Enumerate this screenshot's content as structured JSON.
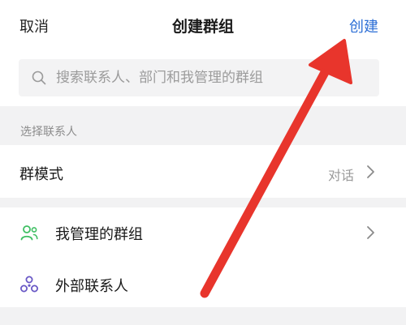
{
  "header": {
    "cancel_label": "取消",
    "title": "创建群组",
    "create_label": "创建"
  },
  "search": {
    "placeholder": "搜索联系人、部门和我管理的群组",
    "value": ""
  },
  "section": {
    "label": "选择联系人"
  },
  "group_mode": {
    "label": "群模式",
    "value": "对话"
  },
  "list": {
    "managed_groups": "我管理的群组",
    "external_contacts": "外部联系人"
  },
  "colors": {
    "accent": "#2d6fd6",
    "managed_icon": "#3fbf63",
    "external_icon": "#6a59c6",
    "annotation_arrow": "#e8352c"
  },
  "icons": {
    "search": "search-icon",
    "managed_groups": "people-group-icon",
    "external_contacts": "triangle-nodes-icon",
    "chevron": "chevron-right-icon",
    "annotation": "red-arrow-icon"
  }
}
